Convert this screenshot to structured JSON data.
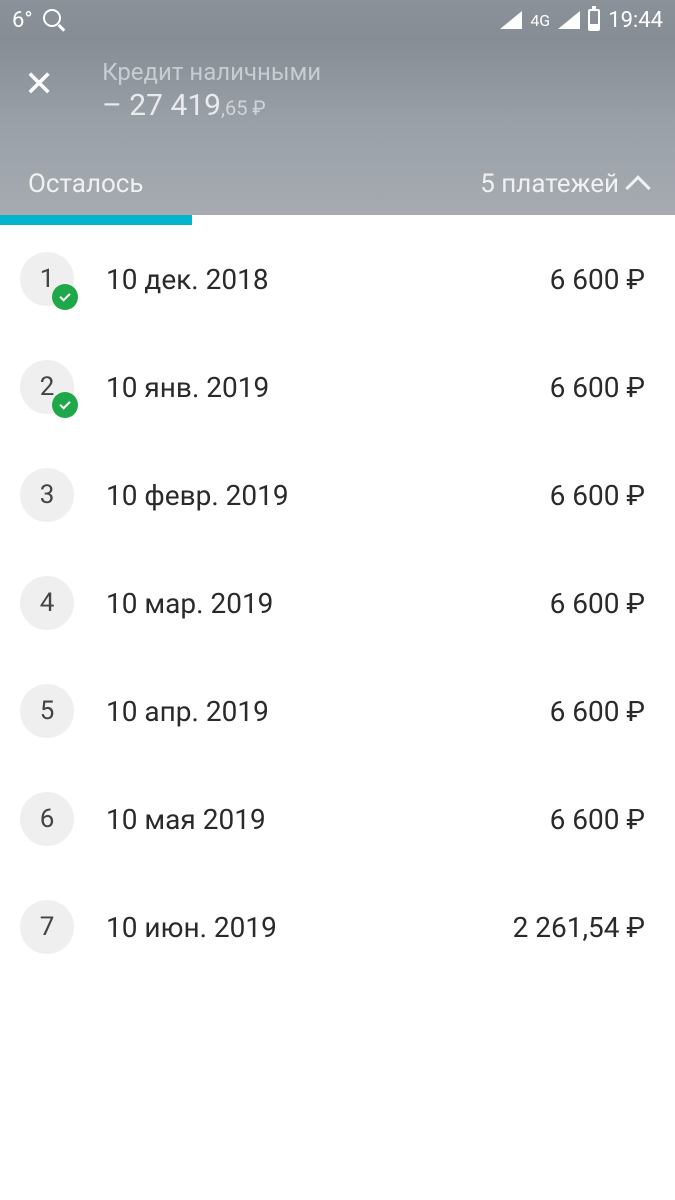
{
  "statusBar": {
    "temperature": "6°",
    "network": "4G",
    "time": "19:44"
  },
  "header": {
    "subtitle": "Кредит наличными",
    "balanceMain": "– 27 419",
    "balanceDecimal": ",65 ₽",
    "remainingLabel": "Осталось",
    "paymentsCount": "5 платежей"
  },
  "payments": [
    {
      "num": "1",
      "date": "10 дек. 2018",
      "amount": "6 600 ₽",
      "completed": true
    },
    {
      "num": "2",
      "date": "10 янв. 2019",
      "amount": "6 600 ₽",
      "completed": true
    },
    {
      "num": "3",
      "date": "10 февр. 2019",
      "amount": "6 600 ₽",
      "completed": false
    },
    {
      "num": "4",
      "date": "10 мар. 2019",
      "amount": "6 600 ₽",
      "completed": false
    },
    {
      "num": "5",
      "date": "10 апр. 2019",
      "amount": "6 600 ₽",
      "completed": false
    },
    {
      "num": "6",
      "date": "10 мая 2019",
      "amount": "6 600 ₽",
      "completed": false
    },
    {
      "num": "7",
      "date": "10 июн. 2019",
      "amount": "2 261,54 ₽",
      "completed": false
    }
  ]
}
